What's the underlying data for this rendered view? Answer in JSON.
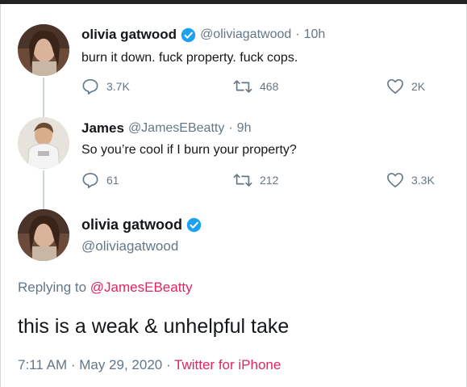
{
  "tweets": [
    {
      "author_name": "olivia gatwood",
      "handle": "@oliviagatwood",
      "separator": "·",
      "time": "10h",
      "text": "burn it down. fuck property. fuck cops.",
      "replies": "3.7K",
      "retweets": "468",
      "likes": "2K"
    },
    {
      "author_name": "James",
      "handle": "@JamesEBeatty",
      "separator": "·",
      "time": "9h",
      "text": "So you’re cool if I burn your property?",
      "replies": "61",
      "retweets": "212",
      "likes": "3.3K"
    }
  ],
  "main_tweet": {
    "author_name": "olivia gatwood",
    "handle": "@oliviagatwood",
    "replying_prefix": "Replying to",
    "replying_to": "@JamesEBeatty",
    "text": "this is a weak & unhelpful take",
    "timestamp": "7:11 AM · May 29, 2020 · ",
    "source": "Twitter for iPhone"
  },
  "icons": [
    "reply-icon",
    "retweet-icon",
    "like-icon",
    "verified-badge-icon"
  ],
  "colors": {
    "text": "#14171a",
    "secondary": "#657786",
    "verified": "#1da1f2",
    "link": "#e0245e",
    "thread_line": "#ccd6dd"
  }
}
